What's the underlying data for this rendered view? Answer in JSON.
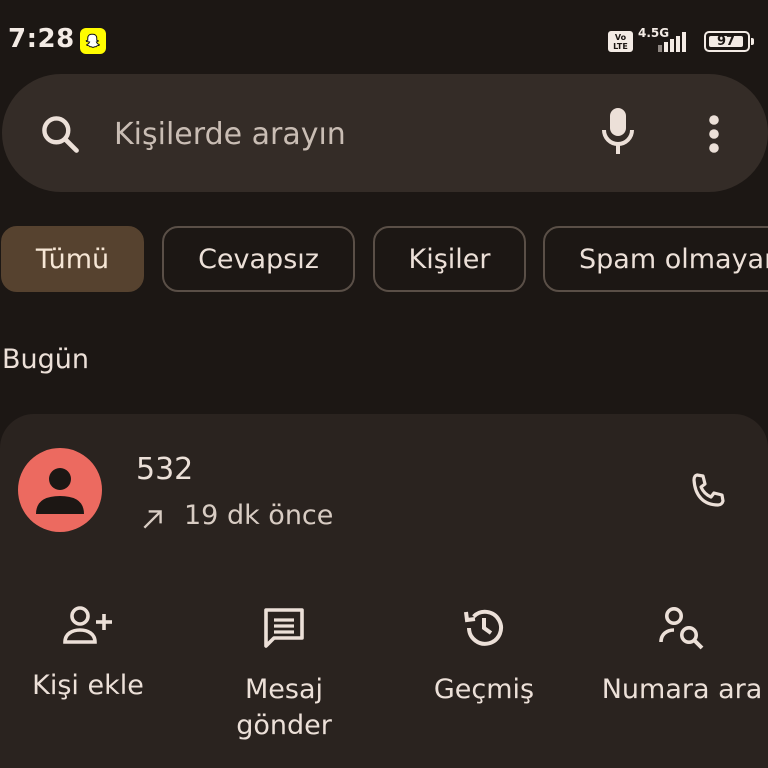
{
  "status_bar": {
    "time": "7:28",
    "volte_top": "Vo",
    "volte_bottom": "LTE",
    "network": "4.5G",
    "battery": "97"
  },
  "search": {
    "placeholder": "Kişilerde arayın"
  },
  "filters": {
    "chips": [
      {
        "label": "Tümü",
        "selected": true
      },
      {
        "label": "Cevapsız",
        "selected": false
      },
      {
        "label": "Kişiler",
        "selected": false
      },
      {
        "label": "Spam olmayan",
        "selected": false
      }
    ]
  },
  "section": {
    "title": "Bugün"
  },
  "call": {
    "number": "532",
    "time": "19 dk önce",
    "avatar_color": "#ec6a60"
  },
  "actions": [
    {
      "label": "Kişi ekle",
      "icon": "add-person-icon"
    },
    {
      "label": "Mesaj\ngönder",
      "icon": "message-icon"
    },
    {
      "label": "Geçmiş",
      "icon": "history-icon"
    },
    {
      "label": "Numara ara",
      "icon": "person-search-icon"
    }
  ],
  "colors": {
    "background": "#1c1714",
    "search_bar": "#342c27",
    "selected_chip": "#56422f",
    "card": "#2a231f"
  }
}
